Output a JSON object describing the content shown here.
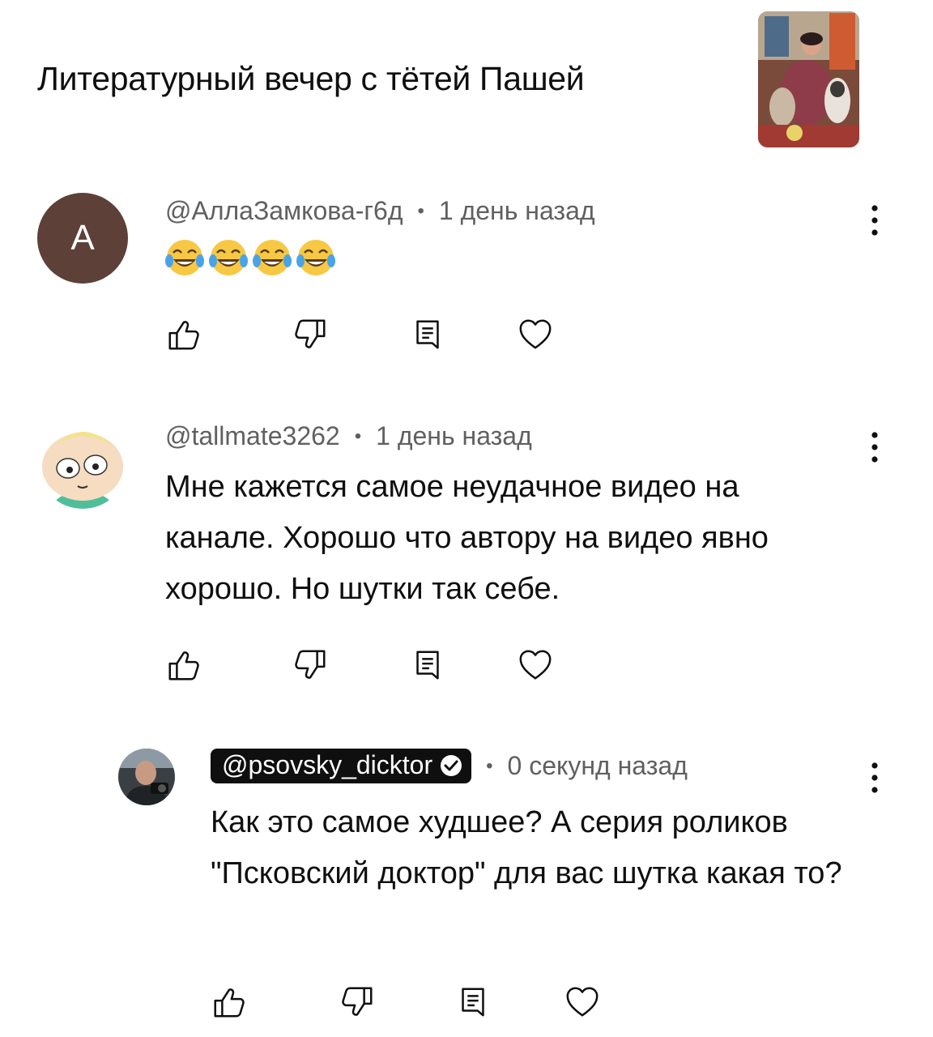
{
  "video": {
    "title": "Литературный вечер с тётей Пашей",
    "thumbnail_icon": "video-thumbnail"
  },
  "comments": [
    {
      "avatar_letter": "A",
      "avatar_color": "#5d4037",
      "author": "@АллаЗамкова-г6д",
      "separator": "•",
      "time": "1 день назад",
      "emoji": [
        "😂",
        "😂",
        "😂",
        "😂"
      ],
      "text": ""
    },
    {
      "avatar_icon": "cartoon-avatar",
      "author": "@tallmate3262",
      "separator": "•",
      "time": "1 день назад",
      "text": "Мне кажется самое неудачное видео на канале. Хорошо что автору на видео явно хорошо. Но шутки так себе."
    },
    {
      "avatar_icon": "photo-avatar",
      "author": "@psovsky_dicktor",
      "verified": true,
      "separator": "•",
      "time": "0 секунд назад",
      "text": "Как это самое худшее? А серия роликов \"Псковский доктор\" для вас шутка какая то?"
    }
  ],
  "actions": {
    "like_icon": "thumbs-up-icon",
    "dislike_icon": "thumbs-down-icon",
    "reply_icon": "reply-icon",
    "heart_icon": "heart-icon",
    "more_icon": "more-vert-icon"
  },
  "colors": {
    "text": "#0f0f0f",
    "meta": "#606060",
    "badge_bg": "#0f0f0f"
  }
}
